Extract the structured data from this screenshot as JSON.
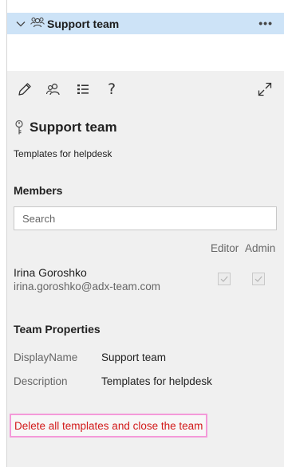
{
  "tree": {
    "team_name": "Support team",
    "more_label": "•••"
  },
  "toolbar": {
    "items": [
      "edit-icon",
      "members-icon",
      "list-icon",
      "help-icon",
      "expand-icon"
    ],
    "help_glyph": "?"
  },
  "details": {
    "title": "Support team",
    "description": "Templates for helpdesk"
  },
  "members": {
    "section_title": "Members",
    "search_placeholder": "Search",
    "columns": [
      "Editor",
      "Admin"
    ],
    "rows": [
      {
        "name": "Irina Goroshko",
        "email": "irina.goroshko@adx-team.com",
        "editor": true,
        "admin": true
      }
    ]
  },
  "properties": {
    "section_title": "Team Properties",
    "rows": [
      {
        "label": "DisplayName",
        "value": "Support team"
      },
      {
        "label": "Description",
        "value": "Templates for helpdesk"
      }
    ]
  },
  "actions": {
    "delete_label": "Delete all templates and close the team"
  },
  "colors": {
    "selection": "#cde3f7",
    "panel_bg": "#f0f0f0",
    "danger_text": "#d21a1a",
    "danger_border": "#f49ad9"
  }
}
